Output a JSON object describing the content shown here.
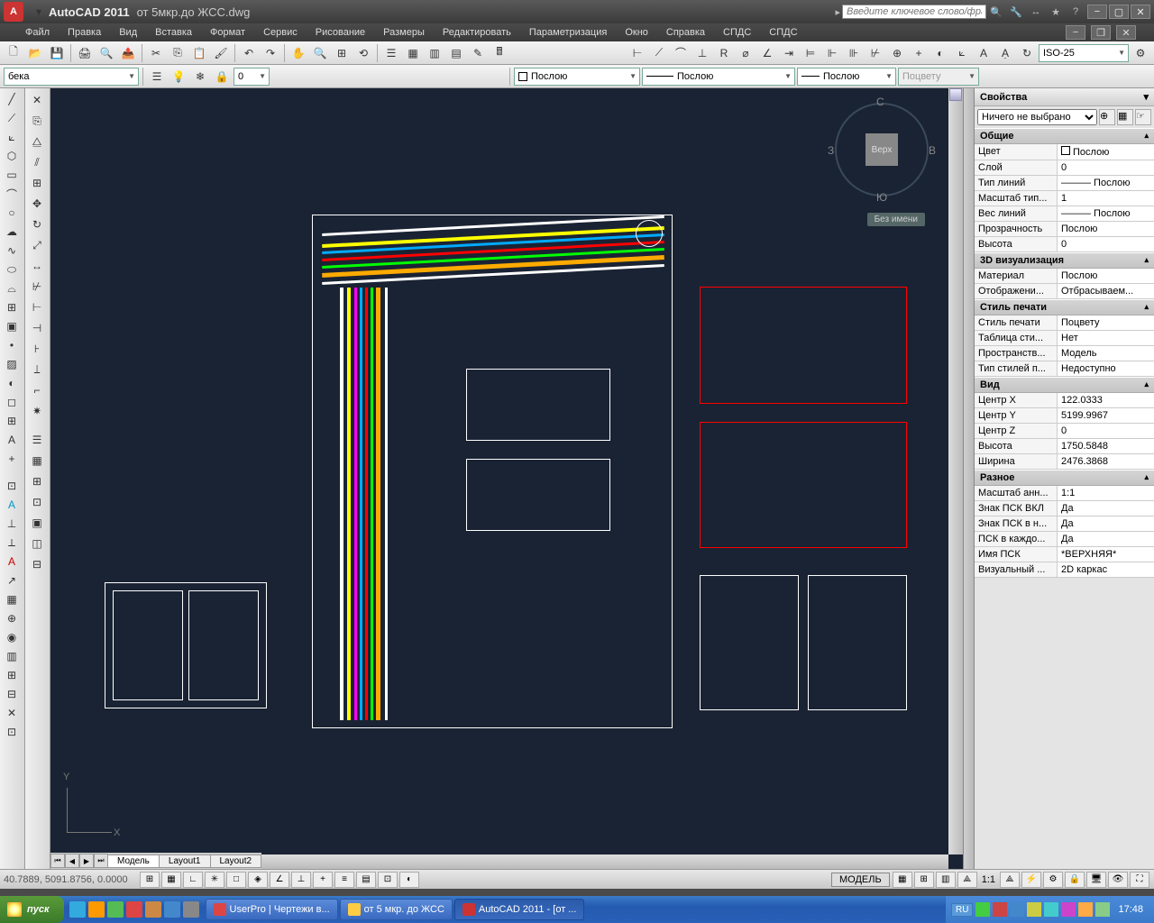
{
  "title": {
    "app": "AutoCAD 2011",
    "doc": "от 5мкр.до ЖСС.dwg"
  },
  "search_placeholder": "Введите ключевое слово/фразу",
  "menu": [
    "Файл",
    "Правка",
    "Вид",
    "Вставка",
    "Формат",
    "Сервис",
    "Рисование",
    "Размеры",
    "Редактировать",
    "Параметризация",
    "Окно",
    "Справка",
    "СПДС",
    "СПДС"
  ],
  "combos": {
    "layer": "бека",
    "layerstate": "0",
    "linetype_combo": "Послою",
    "linetype2": "Послою",
    "lineweight": "Послою",
    "plotcolor": "Поцвету",
    "dimstyle": "ISO-25"
  },
  "viewcube": {
    "top": "Верх",
    "n": "С",
    "s": "Ю",
    "e": "В",
    "w": "З"
  },
  "unnamed_view": "Без имени",
  "tabs": {
    "model": "Модель",
    "l1": "Layout1",
    "l2": "Layout2"
  },
  "status": {
    "coords": "40.7889, 5091.8756, 0.0000",
    "model": "МОДЕЛЬ",
    "scale": "1:1"
  },
  "properties": {
    "title": "Свойства",
    "selection": "Ничего не выбрано",
    "categories": [
      {
        "name": "Общие",
        "rows": [
          {
            "k": "Цвет",
            "v": "Послою",
            "sw": true
          },
          {
            "k": "Слой",
            "v": "0"
          },
          {
            "k": "Тип линий",
            "v": "——— Послою"
          },
          {
            "k": "Масштаб тип...",
            "v": "1"
          },
          {
            "k": "Вес линий",
            "v": "——— Послою"
          },
          {
            "k": "Прозрачность",
            "v": "Послою"
          },
          {
            "k": "Высота",
            "v": "0"
          }
        ]
      },
      {
        "name": "3D визуализация",
        "rows": [
          {
            "k": "Материал",
            "v": "Послою"
          },
          {
            "k": "Отображени...",
            "v": "Отбрасываем..."
          }
        ]
      },
      {
        "name": "Стиль печати",
        "rows": [
          {
            "k": "Стиль печати",
            "v": "Поцвету"
          },
          {
            "k": "Таблица сти...",
            "v": "Нет"
          },
          {
            "k": "Пространств...",
            "v": "Модель"
          },
          {
            "k": "Тип стилей п...",
            "v": "Недоступно"
          }
        ]
      },
      {
        "name": "Вид",
        "rows": [
          {
            "k": "Центр X",
            "v": "122.0333"
          },
          {
            "k": "Центр Y",
            "v": "5199.9967"
          },
          {
            "k": "Центр Z",
            "v": "0"
          },
          {
            "k": "Высота",
            "v": "1750.5848"
          },
          {
            "k": "Ширина",
            "v": "2476.3868"
          }
        ]
      },
      {
        "name": "Разное",
        "rows": [
          {
            "k": "Масштаб анн...",
            "v": "1:1"
          },
          {
            "k": "Знак ПСК ВКЛ",
            "v": "Да"
          },
          {
            "k": "Знак ПСК в н...",
            "v": "Да"
          },
          {
            "k": "ПСК в каждо...",
            "v": "Да"
          },
          {
            "k": "Имя ПСК",
            "v": "*ВЕРХНЯЯ*"
          },
          {
            "k": "Визуальный ...",
            "v": "2D каркас"
          }
        ]
      }
    ]
  },
  "taskbar": {
    "start": "пуск",
    "tasks": [
      {
        "icon": "#d44",
        "label": "UserPro | Чертежи в..."
      },
      {
        "icon": "#fc4",
        "label": "от 5 мкр. до ЖСС"
      },
      {
        "icon": "#c33",
        "label": "AutoCAD 2011 - [от ...",
        "active": true
      }
    ],
    "lang": "RU",
    "time": "17:48"
  }
}
